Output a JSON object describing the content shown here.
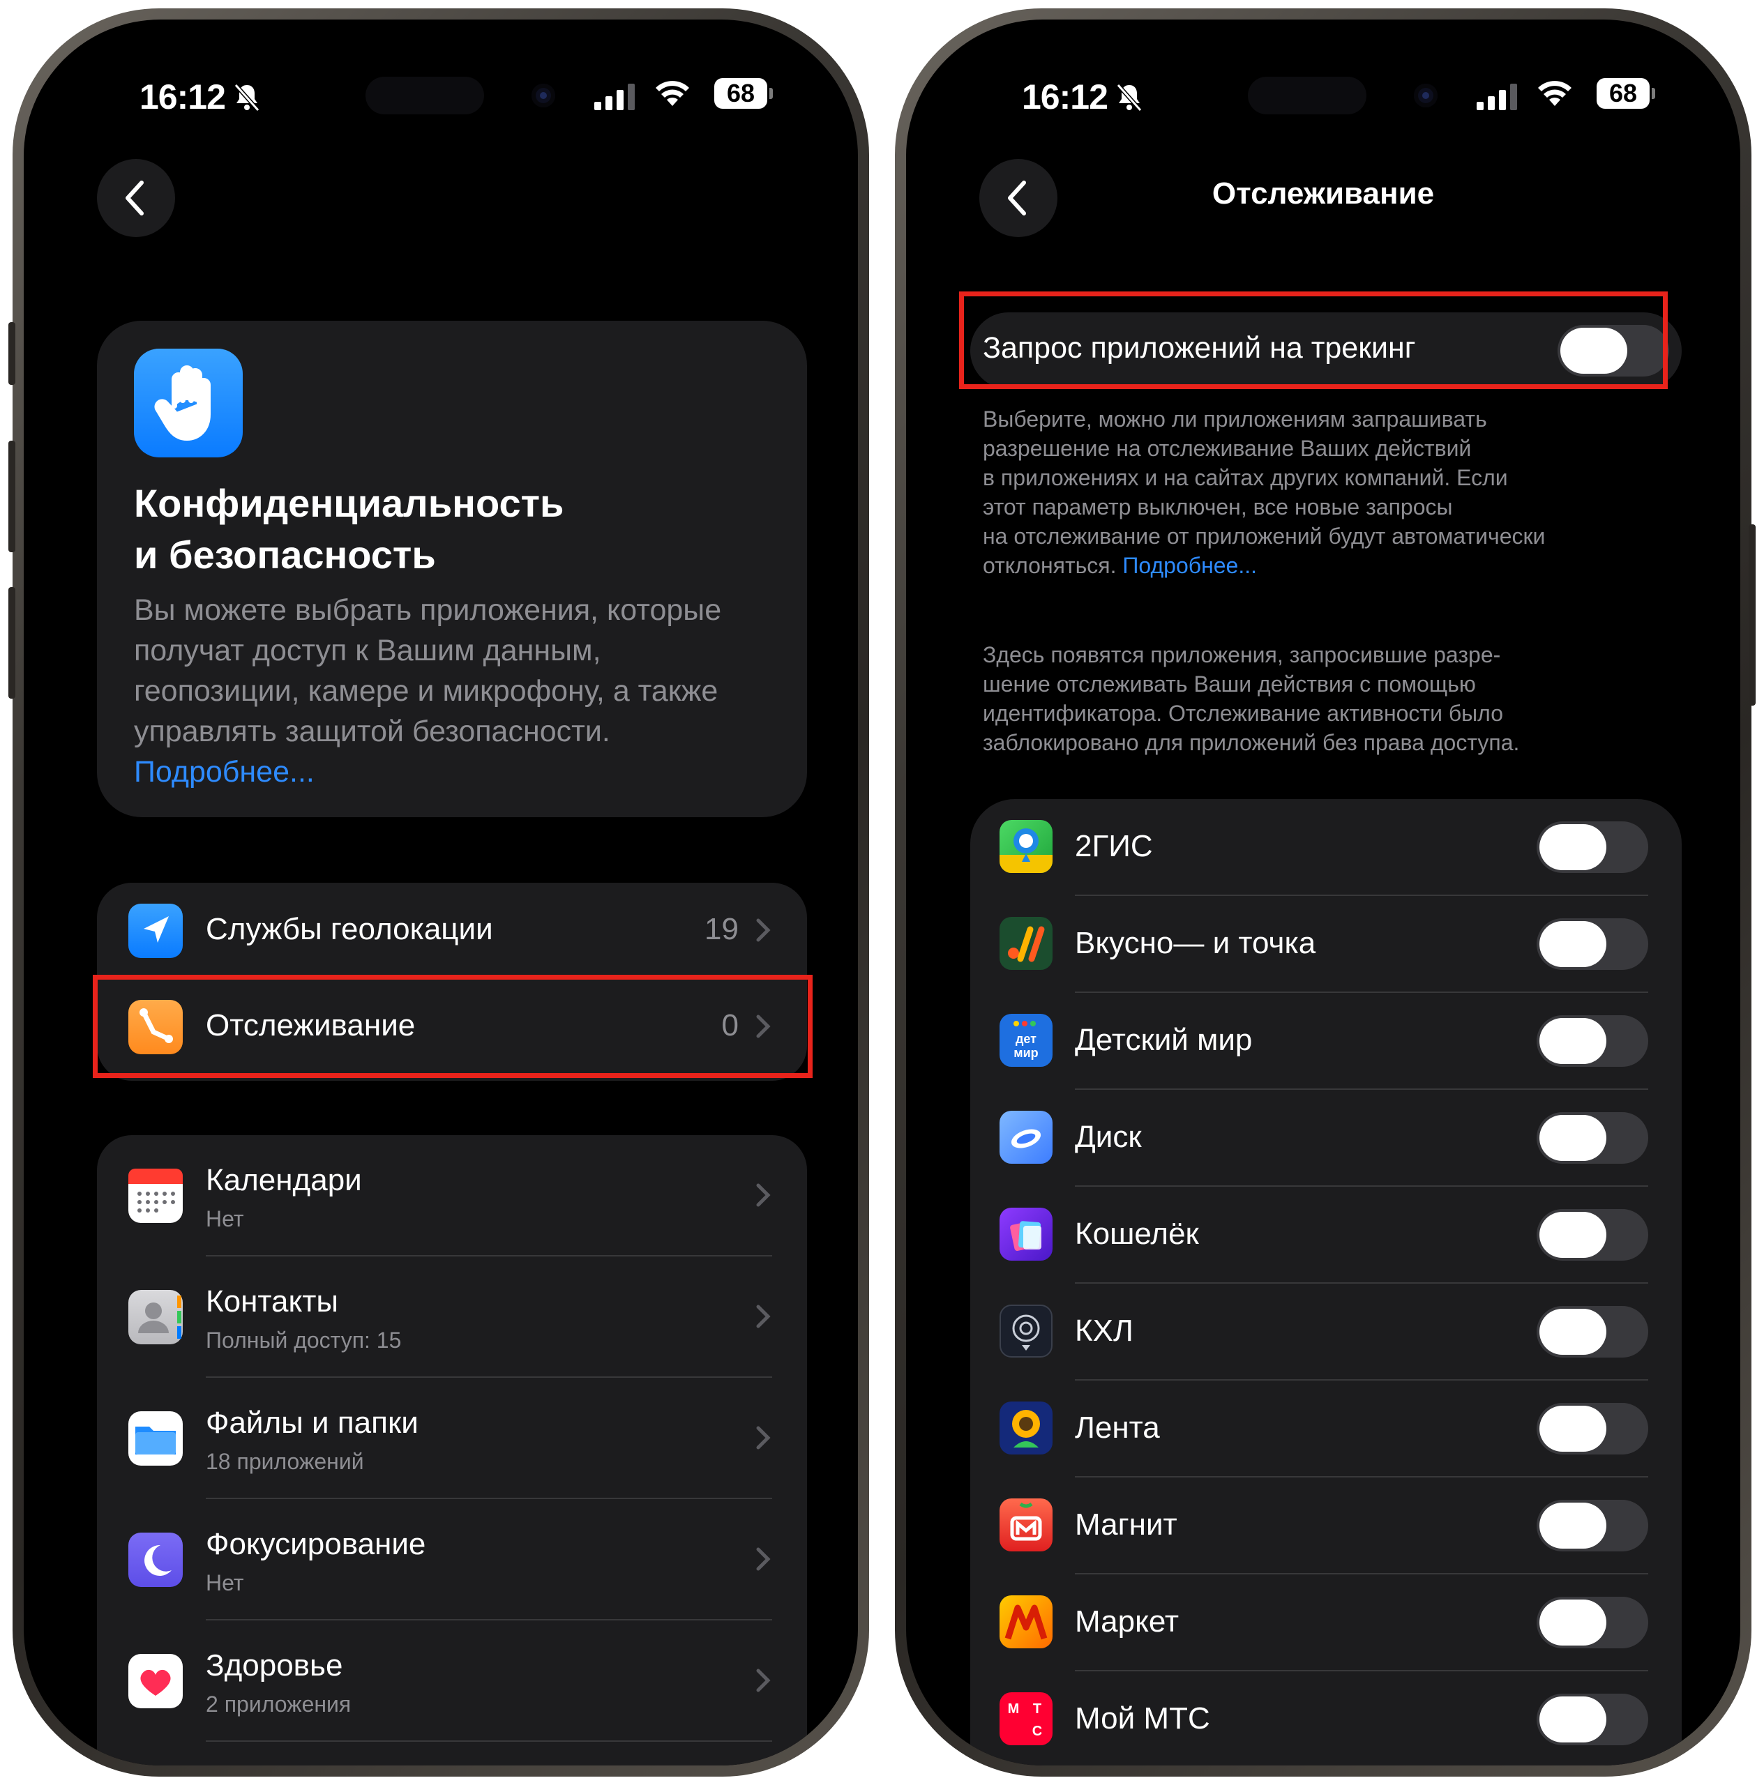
{
  "status": {
    "time": "16:12",
    "battery": "68"
  },
  "left": {
    "header": {
      "title_line1": "Конфиденциальность",
      "title_line2": "и безопасность",
      "desc_line1": "Вы можете выбрать приложения, которые",
      "desc_line2": "получат доступ к Вашим данным,",
      "desc_line3": "геопозиции, камере и микрофону, а также",
      "desc_line4": "управлять защитой безопасности.",
      "link": "Подробнее..."
    },
    "group1": [
      {
        "label": "Службы геолокации",
        "value": "19",
        "icon": "location-arrow-icon"
      },
      {
        "label": "Отслеживание",
        "value": "0",
        "icon": "tracking-icon"
      }
    ],
    "group2": [
      {
        "label": "Календари",
        "sub": "Нет",
        "icon": "calendar-icon"
      },
      {
        "label": "Контакты",
        "sub": "Полный доступ: 15",
        "icon": "contacts-icon"
      },
      {
        "label": "Файлы и папки",
        "sub": "18 приложений",
        "icon": "files-icon"
      },
      {
        "label": "Фокусирование",
        "sub": "Нет",
        "icon": "moon-icon"
      },
      {
        "label": "Здоровье",
        "sub": "2 приложения",
        "icon": "health-heart-icon"
      }
    ]
  },
  "right": {
    "title": "Отслеживание",
    "tracking_toggle": {
      "label": "Запрос приложений на трекинг",
      "on": false
    },
    "note1_lines": [
      "Выберите, можно ли приложениям запрашивать",
      "разрешение на отслеживание Ваших действий",
      "в приложениях и на сайтах других компаний. Если",
      "этот параметр выключен, все новые запросы",
      "на отслеживание от приложений будут автоматически"
    ],
    "note1_last": "отклоняться.",
    "note1_link": "Подробнее...",
    "note2_lines": [
      "Здесь появятся приложения, запросившие разре-",
      "шение отслеживать Ваши действия с помощью",
      "идентификатора. Отслеживание активности было",
      "заблокировано для приложений без права доступа."
    ],
    "apps": [
      {
        "name": "2ГИС",
        "on": false
      },
      {
        "name": "Вкусно— и точка",
        "on": false
      },
      {
        "name": "Детский мир",
        "on": false
      },
      {
        "name": "Диск",
        "on": false
      },
      {
        "name": "Кошелёк",
        "on": false
      },
      {
        "name": "КХЛ",
        "on": false
      },
      {
        "name": "Лента",
        "on": false
      },
      {
        "name": "Магнит",
        "on": false
      },
      {
        "name": "Маркет",
        "on": false
      },
      {
        "name": "Мой МТС",
        "on": false
      }
    ]
  },
  "colors": {
    "highlight": "#e8231b",
    "link": "#2e8bff",
    "card": "#1c1c1e"
  }
}
